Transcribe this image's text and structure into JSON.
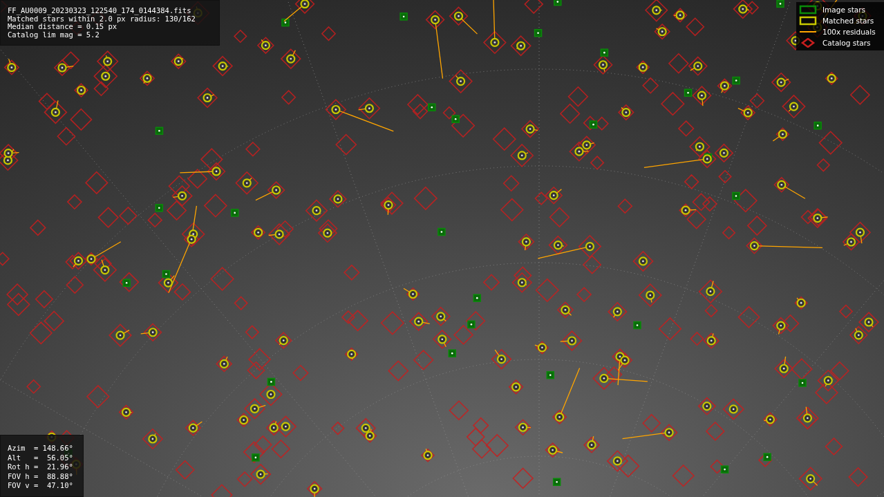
{
  "info_panel": {
    "lines": [
      "FF_AU0009_20230323_122540_174_0144384.fits",
      "Matched stars within 2.0 px radius: 130/162",
      "Median distance = 0.15 px",
      "Catalog lim mag = 5.2"
    ]
  },
  "legend": [
    {
      "kind": "image",
      "label": "Image stars",
      "color": "#0a8a0a"
    },
    {
      "kind": "matched",
      "label": "Matched stars",
      "color": "#c8c800"
    },
    {
      "kind": "residual",
      "label": "100x residuals",
      "color": "#ffa500"
    },
    {
      "kind": "catalog",
      "label": "Catalog stars",
      "color": "#c81e1e"
    }
  ],
  "pointing_panel": {
    "lines": [
      "Azim  = 148.66°",
      "Alt   =  56.05°",
      "Rot h =  21.96°",
      "FOV h =  88.88°",
      "FOV v =  47.10°"
    ]
  }
}
